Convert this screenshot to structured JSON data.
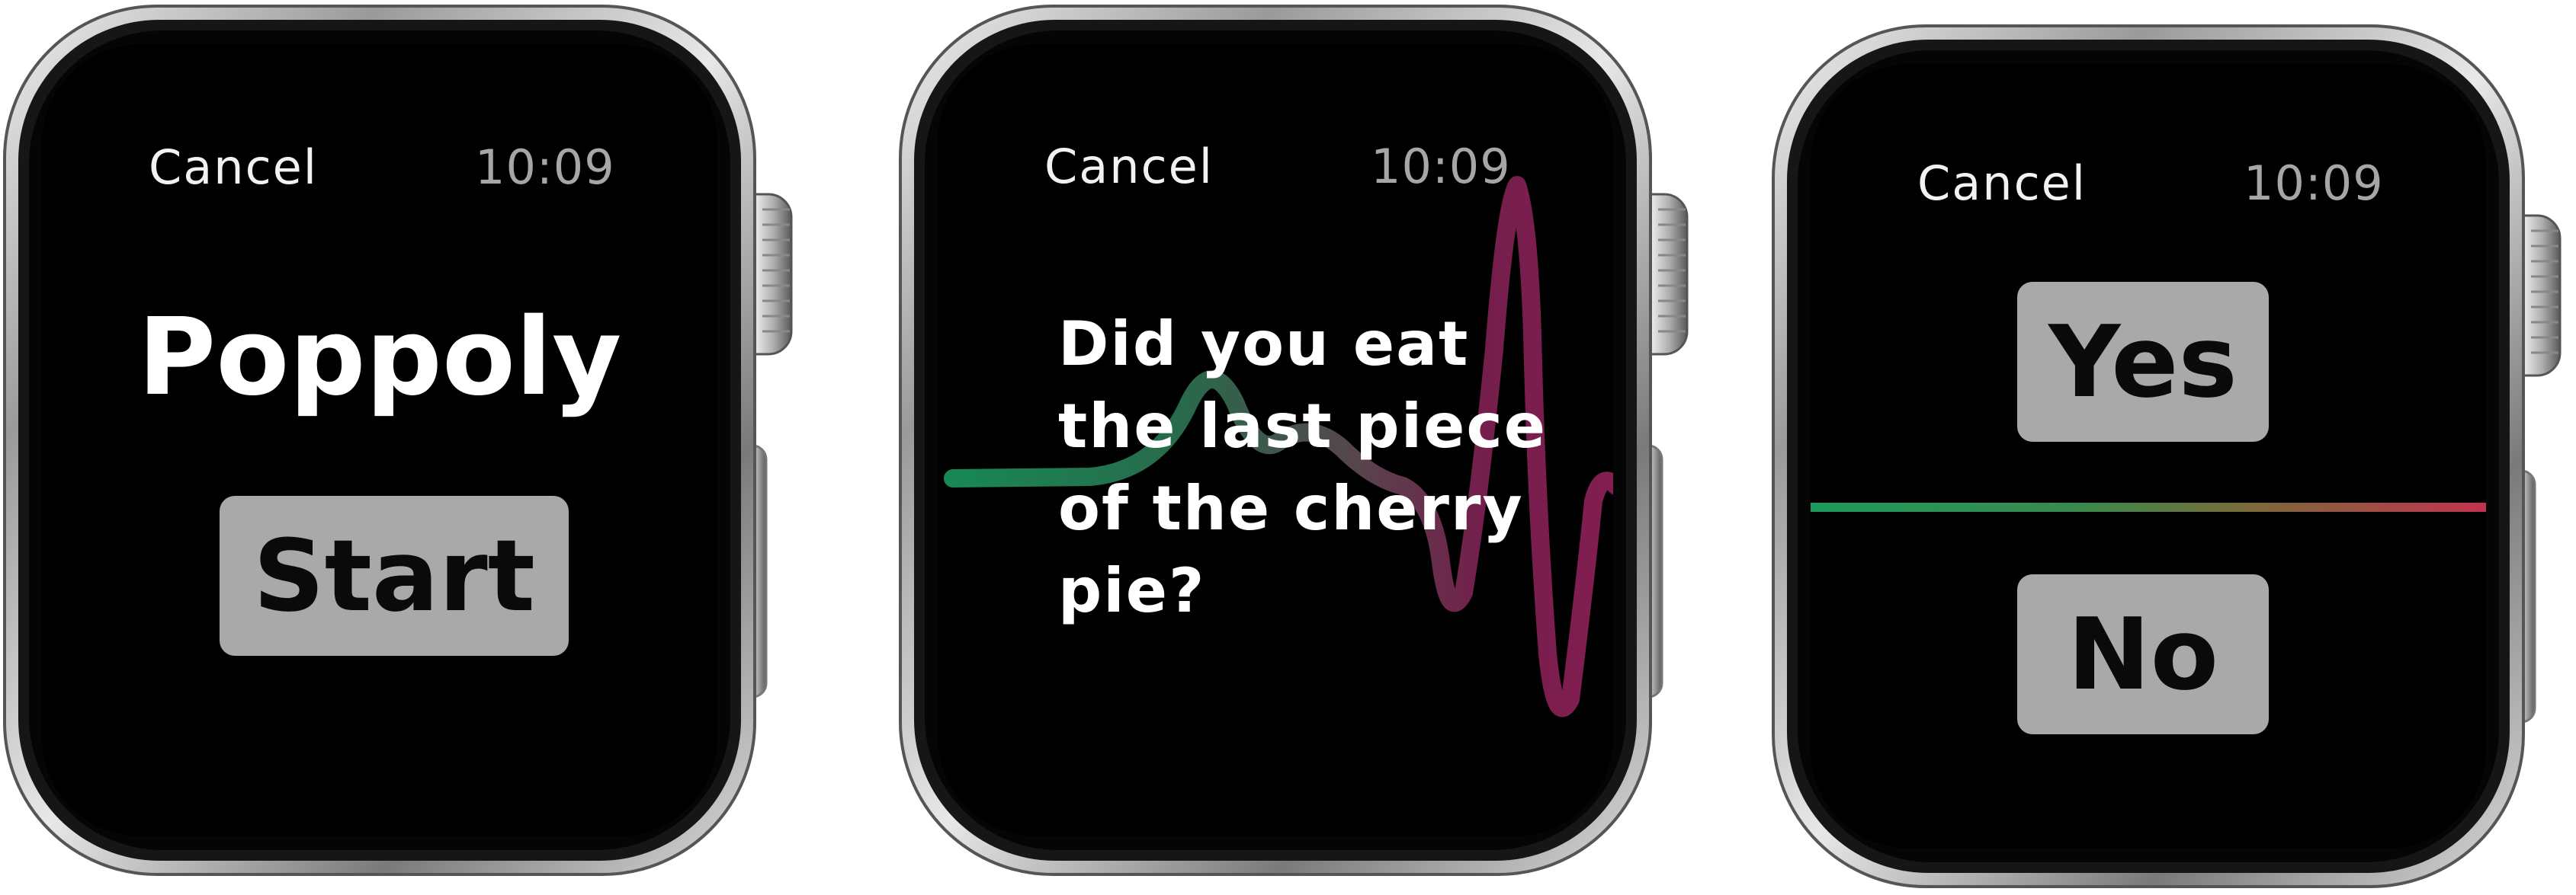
{
  "colors": {
    "screen": "#000000",
    "button_bg": "#a9a9a9",
    "button_text": "#0a0a0a",
    "status_time": "#a6a6a6",
    "status_cancel": "#f2f2f2",
    "line_green": "#1e9a5e",
    "line_red": "#c2334f",
    "wave_magenta": "#8a1f55"
  },
  "screens": [
    {
      "status": {
        "cancel_label": "Cancel",
        "time": "10:09"
      },
      "app_title": "Poppoly",
      "start_label": "Start"
    },
    {
      "status": {
        "cancel_label": "Cancel",
        "time": "10:09"
      },
      "question_lines": [
        "Did you eat",
        "the last piece",
        "of the cherry",
        "pie?"
      ]
    },
    {
      "status": {
        "cancel_label": "Cancel",
        "time": "10:09"
      },
      "yes_label": "Yes",
      "no_label": "No"
    }
  ]
}
